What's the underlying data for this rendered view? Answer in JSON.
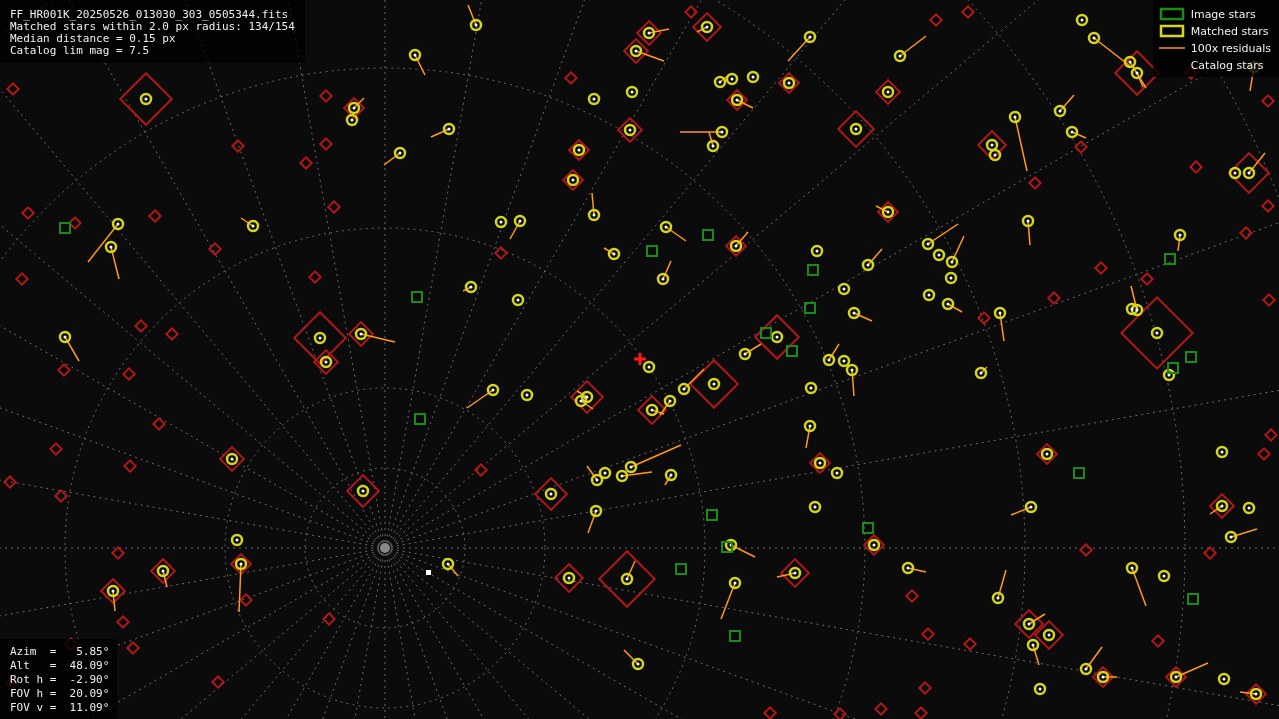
{
  "info_lines": [
    "FF_HR001K_20250526_013030_303_0505344.fits",
    "Matched stars within 2.0 px radius: 134/154",
    "Median distance = 0.15 px",
    "Catalog lim mag = 7.5"
  ],
  "legend": [
    {
      "kind": "image",
      "label": "Image stars"
    },
    {
      "kind": "matched",
      "label": "Matched stars"
    },
    {
      "kind": "residual",
      "label": "100x residuals"
    },
    {
      "kind": "catalog",
      "label": "Catalog stars"
    }
  ],
  "pointing": [
    "Azim  =   5.85°",
    "Alt   =  48.09°",
    "Rot h =  -2.90°",
    "FOV h =  20.09°",
    "FOV v =  11.09°"
  ]
}
